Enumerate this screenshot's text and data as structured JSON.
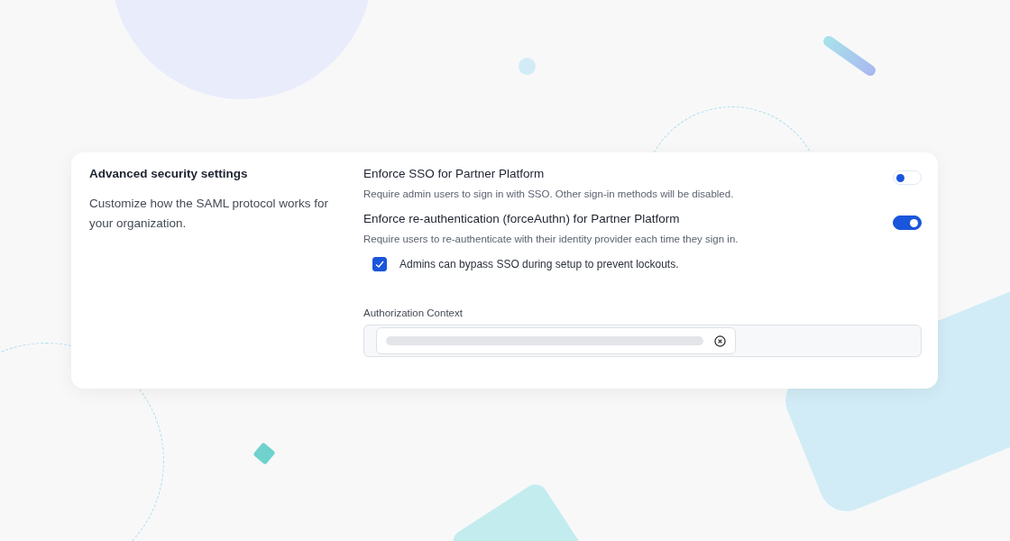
{
  "section": {
    "title": "Advanced security settings",
    "description": "Customize how the SAML protocol works for your organization."
  },
  "settings": [
    {
      "kind": "toggle",
      "label": "Enforce SSO for Partner Platform",
      "description": "Require admin users to sign in with SSO. Other sign-in methods will be disabled.",
      "on": false
    },
    {
      "kind": "toggle",
      "label": "Enforce re-authentication (forceAuthn) for Partner Platform",
      "description": "Require users to re-authenticate with their identity provider each time they sign in.",
      "on": true
    },
    {
      "kind": "checkbox",
      "label": "Admins can bypass SSO during setup to prevent lockouts.",
      "checked": true
    }
  ],
  "authorization_context": {
    "label": "Authorization Context"
  }
}
